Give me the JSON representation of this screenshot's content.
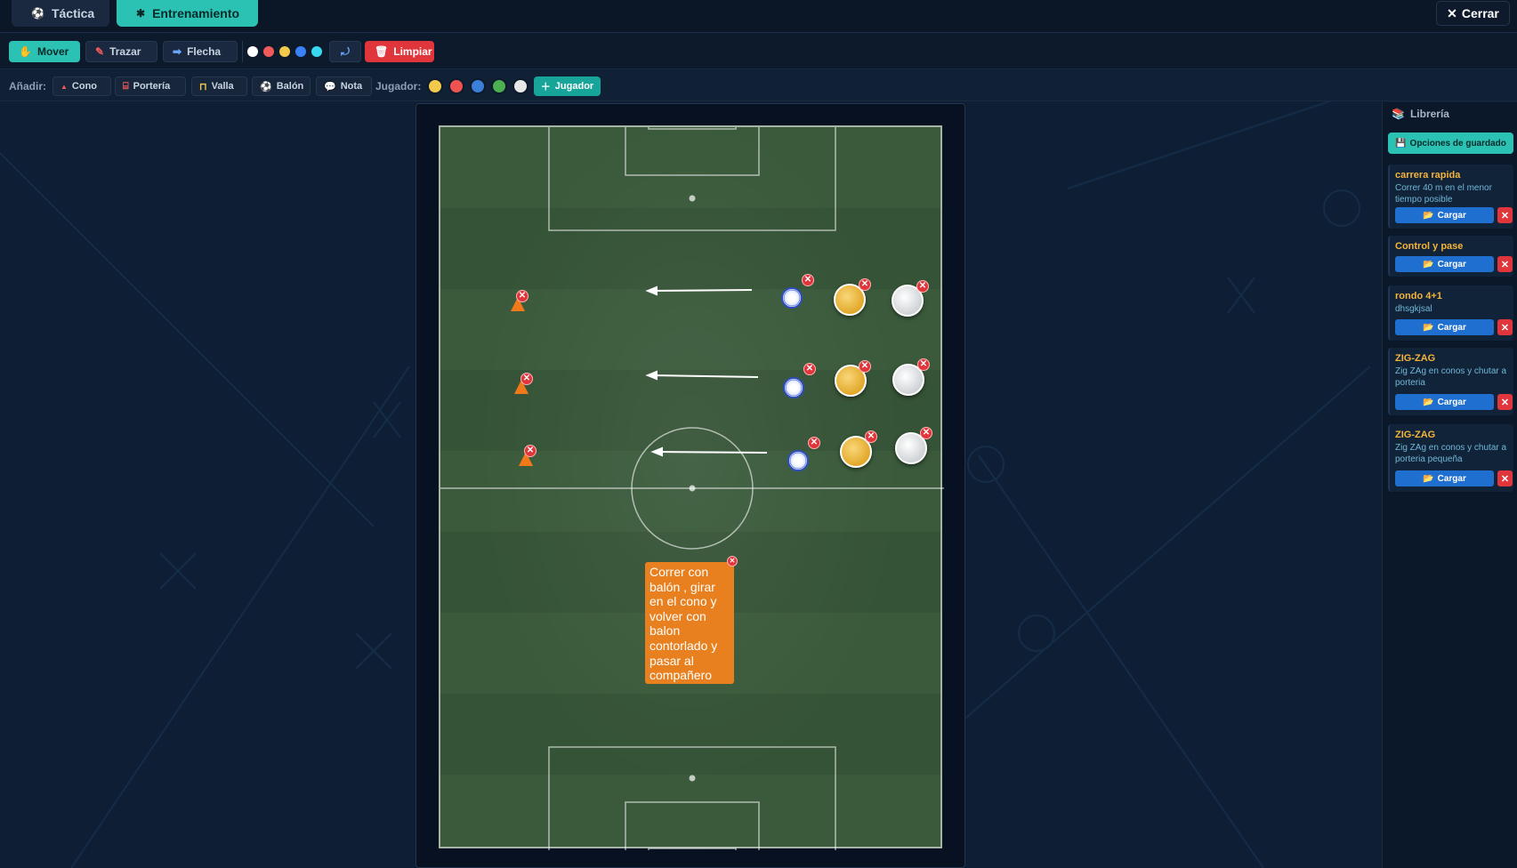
{
  "topbar": {
    "tabs": [
      {
        "label": "Táctica",
        "icon": "soccer-ball-icon"
      },
      {
        "label": "Entrenamiento",
        "icon": "training-icon"
      }
    ],
    "close_label": "Cerrar"
  },
  "toolbar": {
    "move_label": "Mover",
    "draw_label": "Trazar",
    "arrow_label": "Flecha",
    "clear_label": "Limpiar",
    "colors": [
      "#ffffff",
      "#f05a5a",
      "#f2c94c",
      "#3b82f6",
      "#38d9f0"
    ],
    "active_tool": "Mover"
  },
  "add_bar": {
    "label": "Añadir:",
    "items": [
      "Cono",
      "Portería",
      "Valla",
      "Balón",
      "Nota"
    ],
    "player_label": "Jugador:",
    "player_colors": [
      "#f2c94c",
      "#ef5350",
      "#3b7fd9",
      "#4caf50",
      "#e8e8e8"
    ],
    "add_player_label": "Jugador"
  },
  "field": {
    "note_text": "Correr con balón , girar en el cono y volver con balon contorlado y pasar al compañero"
  },
  "library": {
    "title": "Librería",
    "save_options_label": "Opciones de guardado",
    "load_label": "Cargar",
    "items": [
      {
        "name": "carrera rapida",
        "desc": "Correr 40 m en el menor tiempo posible"
      },
      {
        "name": "Control y pase",
        "desc": ""
      },
      {
        "name": "rondo 4+1",
        "desc": "dhsgkjsal"
      },
      {
        "name": "ZIG-ZAG",
        "desc": "Zig ZAg en conos y chutar a porteria"
      },
      {
        "name": "ZIG-ZAG",
        "desc": "Zig ZAg en conos y chutar a porteria pequeña"
      }
    ]
  },
  "colors": {
    "accent": "#2bc2b4",
    "danger": "#e0353b",
    "load_button": "#1f6fd0",
    "note": "#e9801f",
    "pitch": "#3a5a3b"
  }
}
